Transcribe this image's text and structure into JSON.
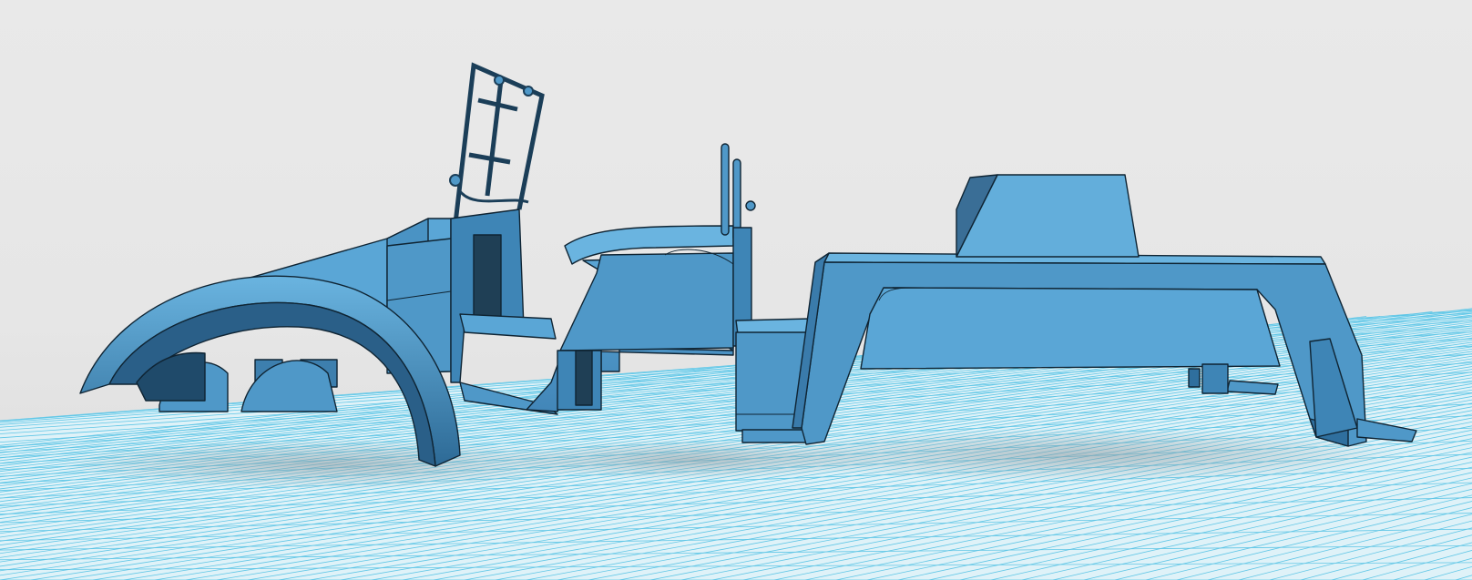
{
  "viewport": {
    "background": "#e8e8e8",
    "grid_line_color": "#5fc6e6",
    "grid_fill_color": "#dff2f8",
    "model_fill": "#4f98c8",
    "model_fill_light": "#63aedb",
    "model_fill_dark": "#2f6f9e",
    "edge_color": "#0f2433",
    "shadow_color": "#9aa6ab"
  },
  "scene": {
    "parts": [
      "front-fender",
      "hood",
      "windshield-frame",
      "steering-column",
      "seat-body",
      "cab-block",
      "rear-bed-frame",
      "bed-top-box"
    ]
  }
}
